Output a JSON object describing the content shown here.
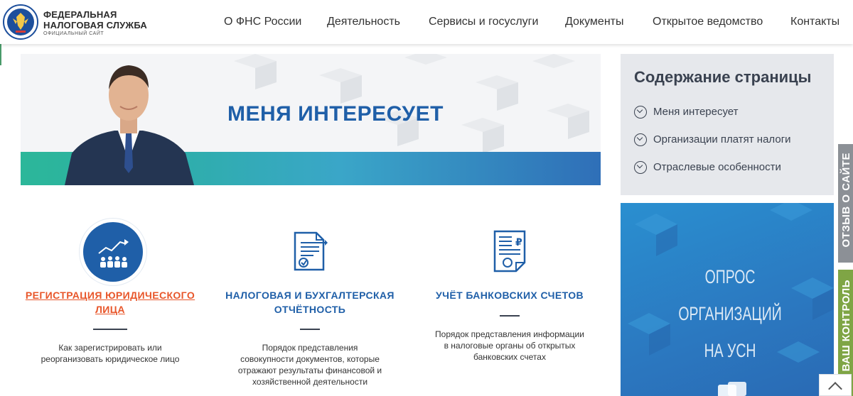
{
  "logo": {
    "line1": "ФЕДЕРАЛЬНАЯ",
    "line2": "НАЛОГОВАЯ СЛУЖБА",
    "subtitle": "ОФИЦИАЛЬНЫЙ САЙТ",
    "emblem_icon": "fns-emblem-icon"
  },
  "nav": [
    {
      "label": "О ФНС России"
    },
    {
      "label": "Деятельность"
    },
    {
      "label": "Сервисы и госуслуги"
    },
    {
      "label": "Документы"
    },
    {
      "label": "Открытое ведомство"
    },
    {
      "label": "Контакты"
    }
  ],
  "hero": {
    "title": "МЕНЯ ИНТЕРЕСУЕТ"
  },
  "toc": {
    "title": "Содержание страницы",
    "items": [
      {
        "label": "Меня интересует",
        "icon": "chevron-down-circle-icon"
      },
      {
        "label": "Организации платят налоги",
        "icon": "chevron-down-circle-icon"
      },
      {
        "label": "Отраслевые особенности",
        "icon": "chevron-down-circle-icon"
      }
    ]
  },
  "survey": {
    "line1": "ОПРОС",
    "line2": "ОРГАНИЗАЦИЙ",
    "line3": "НА УСН"
  },
  "side_tabs": {
    "feedback": "ОТЗЫВ О САЙТЕ",
    "control": "ВАШ КОНТРОЛЬ"
  },
  "cards": [
    {
      "title_line1": "РЕГИСТРАЦИЯ ЮРИДИЧЕСКОГО",
      "title_line2": "ЛИЦА",
      "desc": [
        "Как зарегистрировать или",
        "реорганизовать юридическое лицо"
      ],
      "icon": "growth-people-icon"
    },
    {
      "title_line1": "НАЛОГОВАЯ И БУХГАЛТЕРСКАЯ",
      "title_line2": "ОТЧЁТНОСТЬ",
      "desc": [
        "Порядок представления",
        "совокупности документов, которые",
        "отражают результаты финансовой и",
        "хозяйственной деятельности"
      ],
      "icon": "report-document-icon"
    },
    {
      "title_line1": "УЧЁТ БАНКОВСКИХ СЧЕТОВ",
      "title_line2": "",
      "desc": [
        "Порядок представления информации",
        "в налоговые органы об открытых",
        "банковских счетах"
      ],
      "icon": "ruble-document-icon"
    }
  ],
  "colors": {
    "accent_blue": "#1f5fa8",
    "active_orange": "#e8562a",
    "feedback_tab": "#8c9096",
    "control_tab": "#7fa545"
  }
}
